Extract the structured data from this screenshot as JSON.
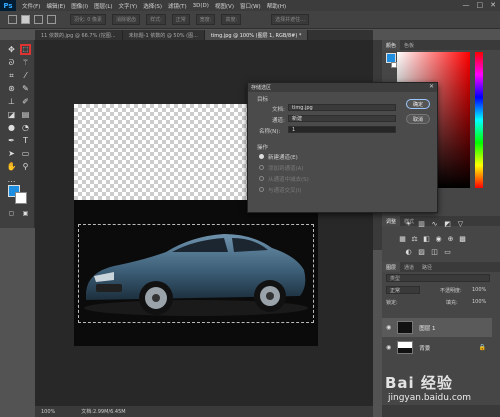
{
  "app": {
    "logo": "Ps"
  },
  "menubar": {
    "items": [
      "文件(F)",
      "编辑(E)",
      "图像(I)",
      "图层(L)",
      "文字(Y)",
      "选择(S)",
      "滤镜(T)",
      "3D(D)",
      "视图(V)",
      "窗口(W)",
      "帮助(H)"
    ],
    "window_controls": [
      "—",
      "□",
      "✕"
    ]
  },
  "options_bar": {
    "feather_label": "羽化: 0 像素",
    "antialias_label": "消除锯齿",
    "style_label": "样式:",
    "style_value": "正常",
    "width_label": "宽度:",
    "height_label": "高度:",
    "refine_button": "选择并遮住..."
  },
  "doc_tabs": [
    {
      "label": "11 依数的.jpg @ 66.7% (挖图...",
      "active": false
    },
    {
      "label": "未标题-1 依数的 @ 50% (图...",
      "active": false
    },
    {
      "label": "timg.jpg @ 100% (图层 1, RGB/8#) *",
      "active": true
    }
  ],
  "status_bar": {
    "zoom": "100%",
    "doc_info": "文档:2.99M/6.45M"
  },
  "panels": {
    "color_tabs": [
      "颜色",
      "色板"
    ],
    "adjust_tabs": [
      "调整",
      "样式"
    ],
    "layer_tabs": [
      "图层",
      "通道",
      "路径"
    ],
    "layer_search_placeholder": "类型",
    "blend_mode": "正常",
    "opacity_label": "不透明度:",
    "opacity_value": "100%",
    "lock_label": "锁定:",
    "fill_label": "填充:",
    "fill_value": "100%",
    "layers": [
      {
        "name": "图层 1",
        "selected": true
      },
      {
        "name": "背景",
        "selected": false
      }
    ]
  },
  "dialog": {
    "title": "存储选区",
    "destination_group": "目标",
    "document_label": "文档:",
    "document_value": "timg.jpg",
    "channel_label": "通道:",
    "channel_value": "新建",
    "name_label": "名称(N):",
    "name_value": "1",
    "operation_group": "操作",
    "options": [
      {
        "label": "新建通道(E)",
        "selected": true,
        "enabled": true
      },
      {
        "label": "添加到通道(A)",
        "selected": false,
        "enabled": false
      },
      {
        "label": "从通道中减去(S)",
        "selected": false,
        "enabled": false
      },
      {
        "label": "与通道交叉(I)",
        "selected": false,
        "enabled": false
      }
    ],
    "ok_button": "确定",
    "cancel_button": "取消"
  },
  "watermark": {
    "brand": "Bai 经验",
    "url": "jingyan.baidu.com"
  },
  "colors": {
    "foreground": "#1e8fe0",
    "background": "#ffffff",
    "accent_highlight": "#dd3333"
  }
}
